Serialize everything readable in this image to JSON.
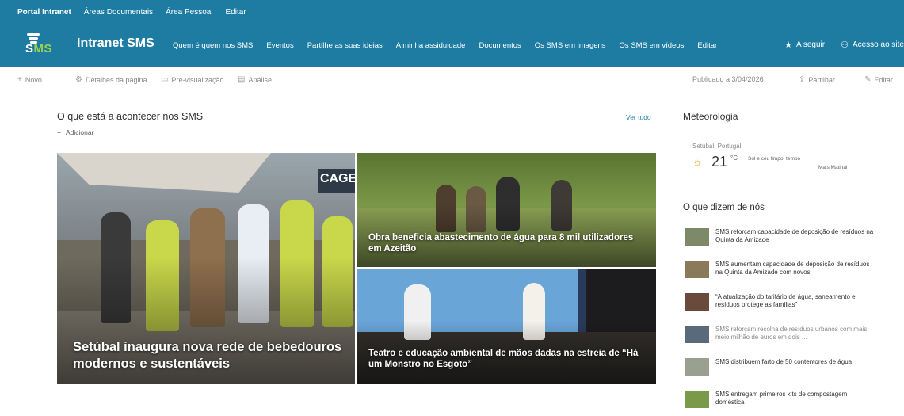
{
  "suitebar": {
    "items": [
      "Portal Intranet",
      "Áreas Documentais",
      "Área Pessoal",
      "Editar"
    ]
  },
  "header": {
    "logo_text_a": "S",
    "logo_text_b": "MS",
    "site_title": "Intranet SMS",
    "nav": [
      "Quem é quem nos SMS",
      "Eventos",
      "Partilhe as suas ideias",
      "A minha assiduidade",
      "Documentos",
      "Os SMS em imagens",
      "Os SMS em vídeos",
      "Editar"
    ],
    "follow_label": "A seguir",
    "access_label": "Acesso ao site"
  },
  "commandbar": {
    "new_label": "Novo",
    "page_details_label": "Detalhes da página",
    "preview_label": "Pré-visualização",
    "analytics_label": "Análise",
    "published_label": "Publicado a 3/04/2026",
    "share_label": "Partilhar",
    "edit_label": "Editar"
  },
  "news": {
    "title": "O que está a acontecer nos SMS",
    "see_all": "Ver tudo",
    "add_label": "Adicionar",
    "tiles": [
      {
        "caption": "Setúbal inaugura nova rede de bebedouros modernos e sustentáveis",
        "sign": "CAGE"
      },
      {
        "caption": "Obra beneficia abastecimento de água para 8 mil utilizadores em Azeitão"
      },
      {
        "caption": "Teatro e educação ambiental de mãos dadas na estreia de “Há um Monstro no Esgoto”"
      }
    ]
  },
  "weather": {
    "title": "Meteorologia",
    "location": "Setúbal, Portugal",
    "temperature": "21",
    "unit": "°C",
    "description": "Sol e céu limpo, tempo",
    "more": "Mais Matinal"
  },
  "said": {
    "title": "O que dizem de nós",
    "items": [
      {
        "text": "SMS reforçam capacidade de deposição de resíduos na Quinta da Amizade"
      },
      {
        "text": "SMS aumentam capacidade de deposição de resíduos na Quinta da Amizade com novos"
      },
      {
        "text": "“A atualização do tarifário de água, saneamento e resíduos protege as famílias”"
      },
      {
        "text": "SMS reforçam recolha de resíduos urbanos com mais meio milhão de euros em dois ..."
      },
      {
        "text": "SMS distribuem farto de 50 contentores de água"
      },
      {
        "text": "SMS entregam primeiros kits de compostagem doméstica"
      }
    ]
  },
  "colors": {
    "brand": "#1e7ca3",
    "accent": "#9bd04e"
  }
}
